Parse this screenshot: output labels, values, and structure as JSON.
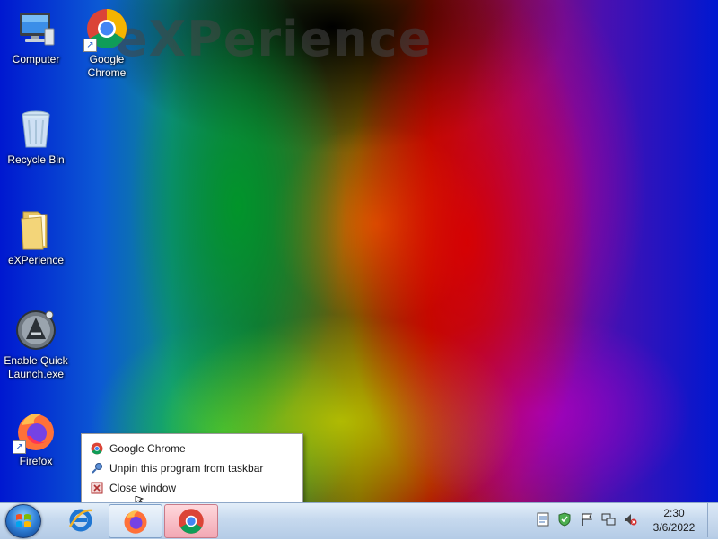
{
  "desktop": {
    "watermark": "eXPerience",
    "icons": [
      {
        "label": "Computer",
        "icon": "computer-icon"
      },
      {
        "label": "Google\nChrome",
        "icon": "chrome-icon"
      },
      {
        "label": "Recycle Bin",
        "icon": "recycle-bin-icon"
      },
      {
        "label": "eXPerience",
        "icon": "folder-icon"
      },
      {
        "label": "Enable Quick\nLaunch.exe",
        "icon": "quick-launch-icon"
      },
      {
        "label": "Firefox",
        "icon": "firefox-icon"
      }
    ]
  },
  "context_menu": {
    "items": [
      {
        "label": "Google Chrome",
        "icon": "chrome-icon"
      },
      {
        "label": "Unpin this program from taskbar",
        "icon": "unpin-icon"
      },
      {
        "label": "Close window",
        "icon": "close-window-icon"
      }
    ]
  },
  "taskbar": {
    "pinned": [
      "start-orb-icon",
      "internet-explorer-icon",
      "firefox-icon",
      "chrome-icon"
    ],
    "active_app": "chrome-icon",
    "tray_icons": [
      "document-icon",
      "security-shield-icon",
      "action-center-flag-icon",
      "network-icon",
      "volume-muted-icon"
    ],
    "clock": {
      "time": "2:30",
      "date": "3/6/2022"
    }
  },
  "colors": {
    "taskbar_top": "#e3eef9",
    "taskbar_bottom": "#b4cbe6",
    "chrome_active_button": "#f2a8b4",
    "desktop_blue": "#0018d0"
  }
}
